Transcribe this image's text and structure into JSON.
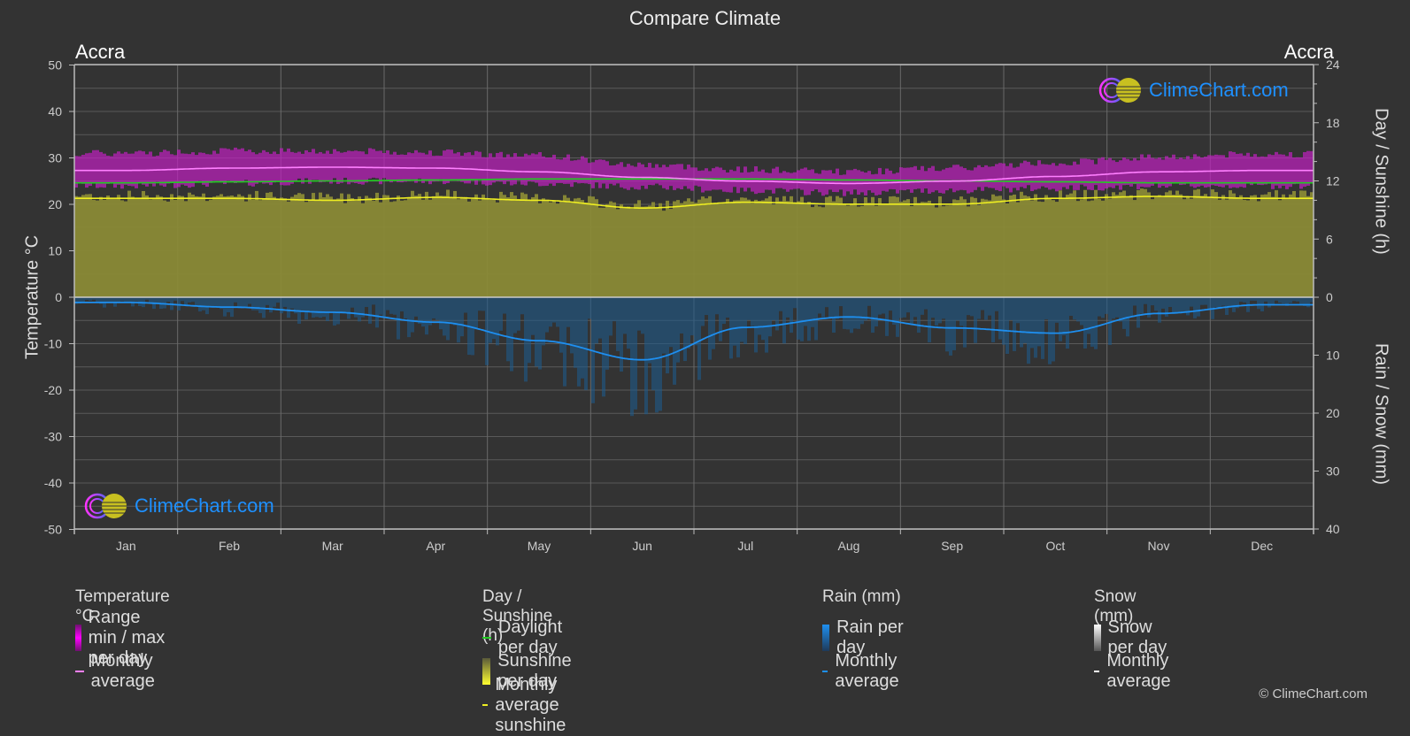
{
  "title": "Compare Climate",
  "city_left": "Accra",
  "city_right": "Accra",
  "brand": "ClimeChart.com",
  "copyright": "© ClimeChart.com",
  "colors": {
    "background": "#333333",
    "temp_range": "#c020c0",
    "temp_avg": "#ff80ff",
    "daylight": "#22cc22",
    "sunshine_fill": "#8a8a36",
    "sunshine_avg": "#eeee22",
    "rain_fill": "#1e5a8a",
    "rain_avg": "#1e8ff0",
    "snow_avg": "#ffffff",
    "grid": "#5a5a5a",
    "brand": "#1e90ff"
  },
  "legend": {
    "temperature": {
      "heading": "Temperature °C",
      "items": [
        "Range min / max per day",
        "Monthly average"
      ]
    },
    "sunshine": {
      "heading": "Day / Sunshine (h)",
      "items": [
        "Daylight per day",
        "Sunshine per day",
        "Monthly average sunshine"
      ]
    },
    "rain": {
      "heading": "Rain (mm)",
      "items": [
        "Rain per day",
        "Monthly average"
      ]
    },
    "snow": {
      "heading": "Snow (mm)",
      "items": [
        "Snow per day",
        "Monthly average"
      ]
    }
  },
  "chart_data": {
    "type": "line",
    "title": "Compare Climate",
    "categories": [
      "Jan",
      "Feb",
      "Mar",
      "Apr",
      "May",
      "Jun",
      "Jul",
      "Aug",
      "Sep",
      "Oct",
      "Nov",
      "Dec"
    ],
    "left_axis": {
      "label": "Temperature °C",
      "range": [
        -50,
        50
      ],
      "ticks": [
        50,
        40,
        30,
        20,
        10,
        0,
        -10,
        -20,
        -30,
        -40,
        -50
      ]
    },
    "right_axis_top": {
      "label": "Day / Sunshine (h)",
      "range": [
        0,
        24
      ],
      "ticks": [
        24,
        18,
        12,
        6,
        0
      ]
    },
    "right_axis_bottom": {
      "label": "Rain / Snow (mm)",
      "range": [
        0,
        40
      ],
      "ticks": [
        10,
        20,
        30,
        40
      ]
    },
    "grid": true,
    "series": [
      {
        "name": "Temperature max (range top)",
        "axis": "temperature",
        "values": [
          31.0,
          31.5,
          31.5,
          31.2,
          30.5,
          28.5,
          27.5,
          27.0,
          27.8,
          29.0,
          30.2,
          30.8
        ]
      },
      {
        "name": "Temperature min (range bottom)",
        "axis": "temperature",
        "values": [
          24.0,
          24.5,
          25.0,
          25.0,
          24.5,
          23.8,
          23.0,
          22.5,
          23.0,
          23.5,
          24.0,
          24.0
        ]
      },
      {
        "name": "Temperature monthly average",
        "axis": "temperature",
        "values": [
          27.3,
          27.8,
          28.0,
          27.8,
          27.0,
          25.8,
          25.0,
          24.5,
          25.0,
          26.0,
          27.0,
          27.3
        ]
      },
      {
        "name": "Daylight per day",
        "axis": "sunshine",
        "values": [
          11.8,
          11.9,
          12.0,
          12.1,
          12.2,
          12.2,
          12.2,
          12.1,
          12.0,
          11.9,
          11.8,
          11.8
        ]
      },
      {
        "name": "Monthly average sunshine",
        "axis": "sunshine",
        "values": [
          10.2,
          10.2,
          10.0,
          10.3,
          10.0,
          9.2,
          9.8,
          9.6,
          9.6,
          10.2,
          10.4,
          10.2
        ]
      },
      {
        "name": "Rain monthly average",
        "axis": "rain",
        "values": [
          0.9,
          1.7,
          2.6,
          4.3,
          7.5,
          10.8,
          5.2,
          3.4,
          5.3,
          6.2,
          2.8,
          1.3
        ]
      },
      {
        "name": "Snow monthly average",
        "axis": "rain",
        "values": [
          0,
          0,
          0,
          0,
          0,
          0,
          0,
          0,
          0,
          0,
          0,
          0
        ]
      }
    ]
  }
}
